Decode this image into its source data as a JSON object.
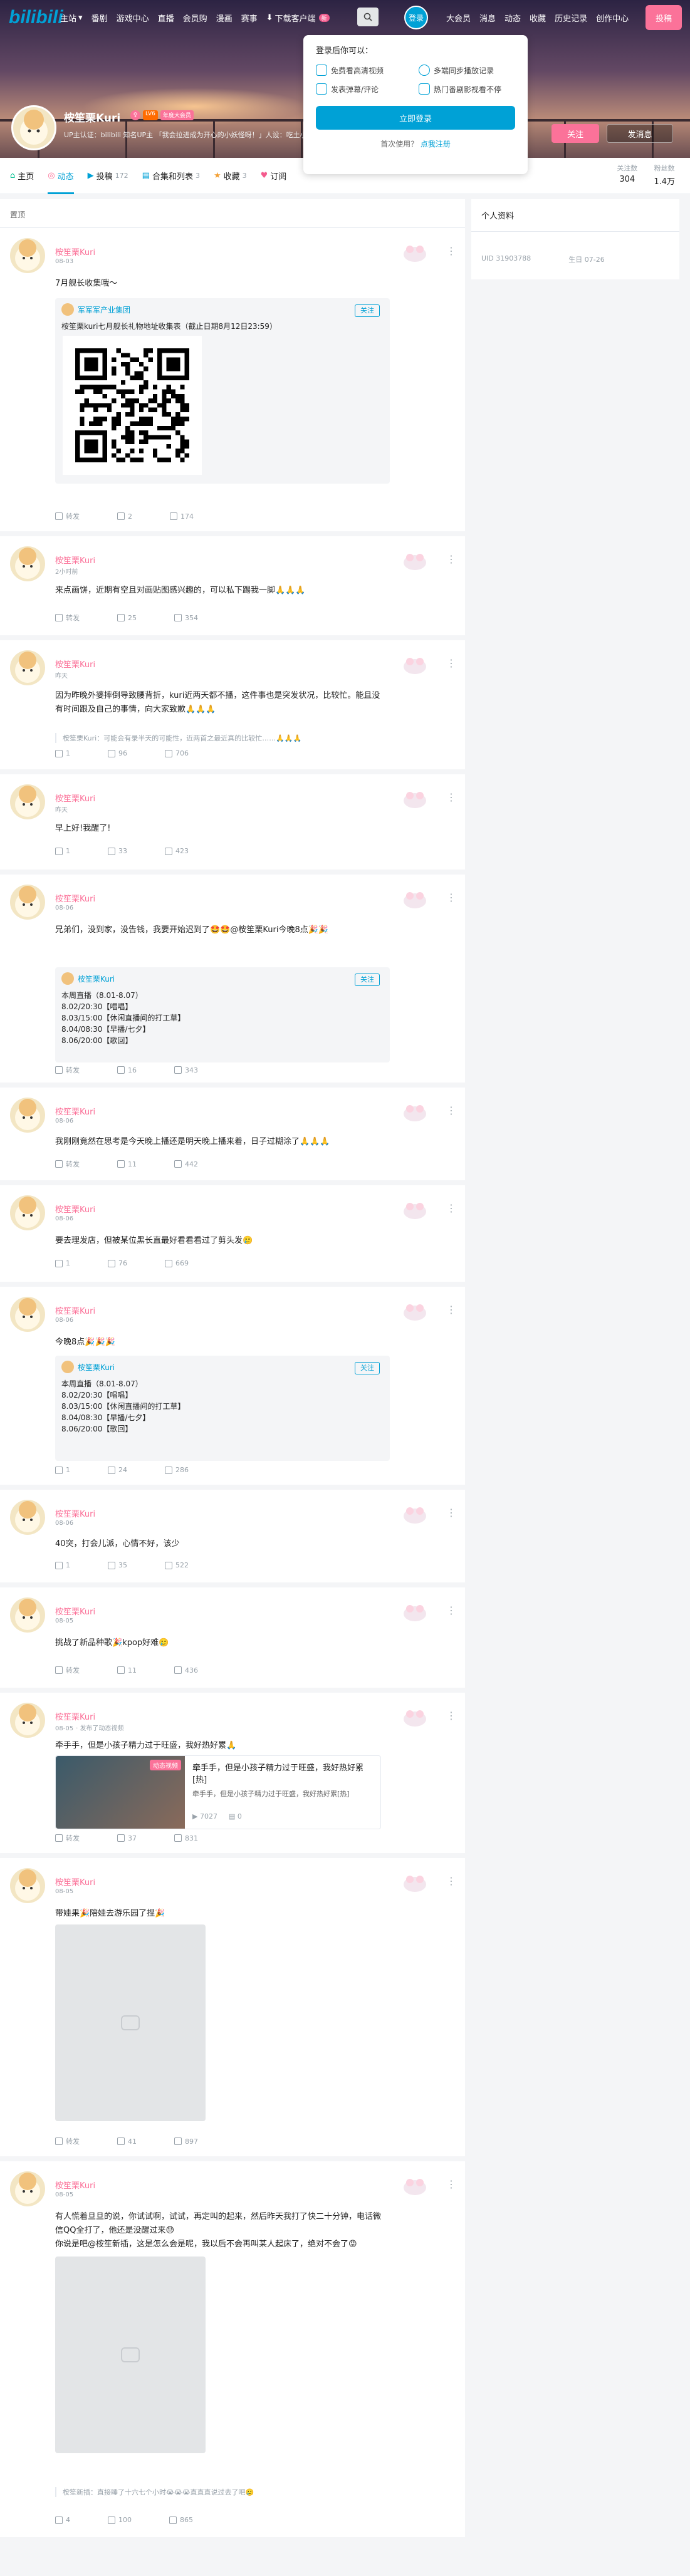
{
  "topbar": {
    "logo": "bilibili",
    "nav": [
      "主站",
      "番剧",
      "游戏中心",
      "直播",
      "会员购",
      "漫画",
      "赛事"
    ],
    "download": "下载客户端",
    "download_badge": "新",
    "login": "登录",
    "right_nav": [
      "大会员",
      "消息",
      "动态",
      "收藏",
      "历史记录",
      "创作中心"
    ],
    "post": "投稿"
  },
  "login_popup": {
    "title": "登录后你可以：",
    "features": [
      "免费看高清视频",
      "多端同步播放记录",
      "发表弹幕/评论",
      "热门番剧影视看不停"
    ],
    "login_button": "立即登录",
    "register_prompt": "首次使用？",
    "register_link": "点我注册"
  },
  "profile": {
    "name": "桉笙栗Kuri",
    "level": "LV6",
    "vip": "年度大会员",
    "bio": "UP主认证：bilibili 知名UP主 「我会拉进成为开心的小妖怪呀！」人设：吃土小偶像",
    "follow": "关注",
    "message": "发消息",
    "stats": [
      {
        "label": "关注数",
        "value": "304"
      },
      {
        "label": "粉丝数",
        "value": "1.4万"
      }
    ]
  },
  "tabs": [
    {
      "label": "主页",
      "count": ""
    },
    {
      "label": "动态",
      "count": ""
    },
    {
      "label": "投稿",
      "count": "172"
    },
    {
      "label": "合集和列表",
      "count": "3"
    },
    {
      "label": "收藏",
      "count": "3"
    },
    {
      "label": "订阅",
      "count": ""
    }
  ],
  "feed_header": "置顶",
  "sidebar": {
    "title": "个人资料",
    "uid": "UID 31903788",
    "birthday": "生日 07-26"
  },
  "posts": [
    {
      "name": "桉笙栗Kuri",
      "time": "08-03",
      "text": "7月舰长收集哦～",
      "fwd_name": "军军军产业集团",
      "fwd_text": "桉笙栗kuri七月舰长礼物地址收集表（截止日期8月12日23:59）",
      "fwd_follow": "关注",
      "share": "转发",
      "comment": "2",
      "like": "174"
    },
    {
      "name": "桉笙栗Kuri",
      "time": "2小时前",
      "text": "来点画饼，近期有空且对画贴图感兴趣的，可以私下踢我一脚🙏🙏🙏",
      "share": "转发",
      "comment": "25",
      "like": "354"
    },
    {
      "name": "桉笙栗Kuri",
      "time": "昨天",
      "text": "因为昨晚外婆摔倒导致腰背折，kuri近两天都不播，这件事也是突发状况，比较忙。能且没有时间跟及自己的事情，向大家致歉🙏🙏🙏",
      "comment_preview": "桉笙栗Kuri：可能会有录半天的可能性，近两首之最近真的比较忙……🙏🙏🙏",
      "share": "1",
      "comment": "96",
      "like": "706"
    },
    {
      "name": "桉笙栗Kuri",
      "time": "昨天",
      "text": "早上好!我醒了!",
      "share": "1",
      "comment": "33",
      "like": "423"
    },
    {
      "name": "桉笙栗Kuri",
      "time": "08-06",
      "text": "兄弟们，没到家，没告钱，我要开始迟到了🤩🤩@桉笙栗Kuri今晚8点🎉🎉",
      "fwd_name": "桉笙栗Kuri",
      "fwd_text": "本周直播（8.01-8.07）\n8.02/20:30【唱唱】\n8.03/15:00【休闲直播间的打工草】\n8.04/08:30【早播/七夕】\n8.06/20:00【歌回】",
      "fwd_follow": "关注",
      "share": "转发",
      "comment": "16",
      "like": "343"
    },
    {
      "name": "桉笙栗Kuri",
      "time": "08-06",
      "text": "我刚刚竟然在思考是今天晚上播还是明天晚上播来着，日子过糊涂了🙏🙏🙏",
      "share": "转发",
      "comment": "11",
      "like": "442"
    },
    {
      "name": "桉笙栗Kuri",
      "time": "08-06",
      "text": "要去理发店，但被某位黑长直最好看看看过了剪头发🥲",
      "share": "1",
      "comment": "76",
      "like": "669"
    },
    {
      "name": "桉笙栗Kuri",
      "time": "08-06",
      "text": "今晚8点🎉🎉🎉",
      "fwd_name": "桉笙栗Kuri",
      "fwd_text": "本周直播（8.01-8.07）\n8.02/20:30【唱唱】\n8.03/15:00【休闲直播间的打工草】\n8.04/08:30【早播/七夕】\n8.06/20:00【歌回】",
      "fwd_follow": "关注",
      "share": "1",
      "comment": "24",
      "like": "286"
    },
    {
      "name": "桉笙栗Kuri",
      "time": "08-06",
      "text": "40突，打会儿派，心情不好，该少",
      "share": "1",
      "comment": "35",
      "like": "522"
    },
    {
      "name": "桉笙栗Kuri",
      "time": "08-05",
      "text": "挑战了新品种歌🎉kpop好难🥲",
      "share": "转发",
      "comment": "11",
      "like": "436"
    },
    {
      "name": "桉笙栗Kuri",
      "time": "08-05",
      "time_extra": "· 发布了动态视频",
      "text": "牵手手，但是小孩子精力过于旺盛，我好热好累🙏",
      "video_title": "牵手手，但是小孩子精力过于旺盛，我好热好累[热]",
      "video_sub": "牵手手，但是小孩子精力过于旺盛，我好热好累[热]",
      "video_tag": "动态视频",
      "video_views": "7027",
      "video_danmaku": "0",
      "share": "转发",
      "comment": "37",
      "like": "831"
    },
    {
      "name": "桉笙栗Kuri",
      "time": "08-05",
      "text": "带娃果🎉陪娃去游乐园了捏🎉",
      "share": "转发",
      "comment": "41",
      "like": "897"
    },
    {
      "name": "桉笙栗Kuri",
      "time": "08-05",
      "text": "有人慌着旦旦的说，你试试啊，试试，再定叫的起来，然后昨天我打了快二十分钟，电话微信QQ全打了，他还是没醒过来😓\n你说是吧@桉笙新插，这是怎么会是呢，我以后不会再叫某人起床了，绝对不会了😡",
      "comment_preview": "桉笙新插：直接睡了十六七个小时😭😭😭直直直说过去了吧🥲",
      "share": "4",
      "comment": "100",
      "like": "865"
    }
  ]
}
